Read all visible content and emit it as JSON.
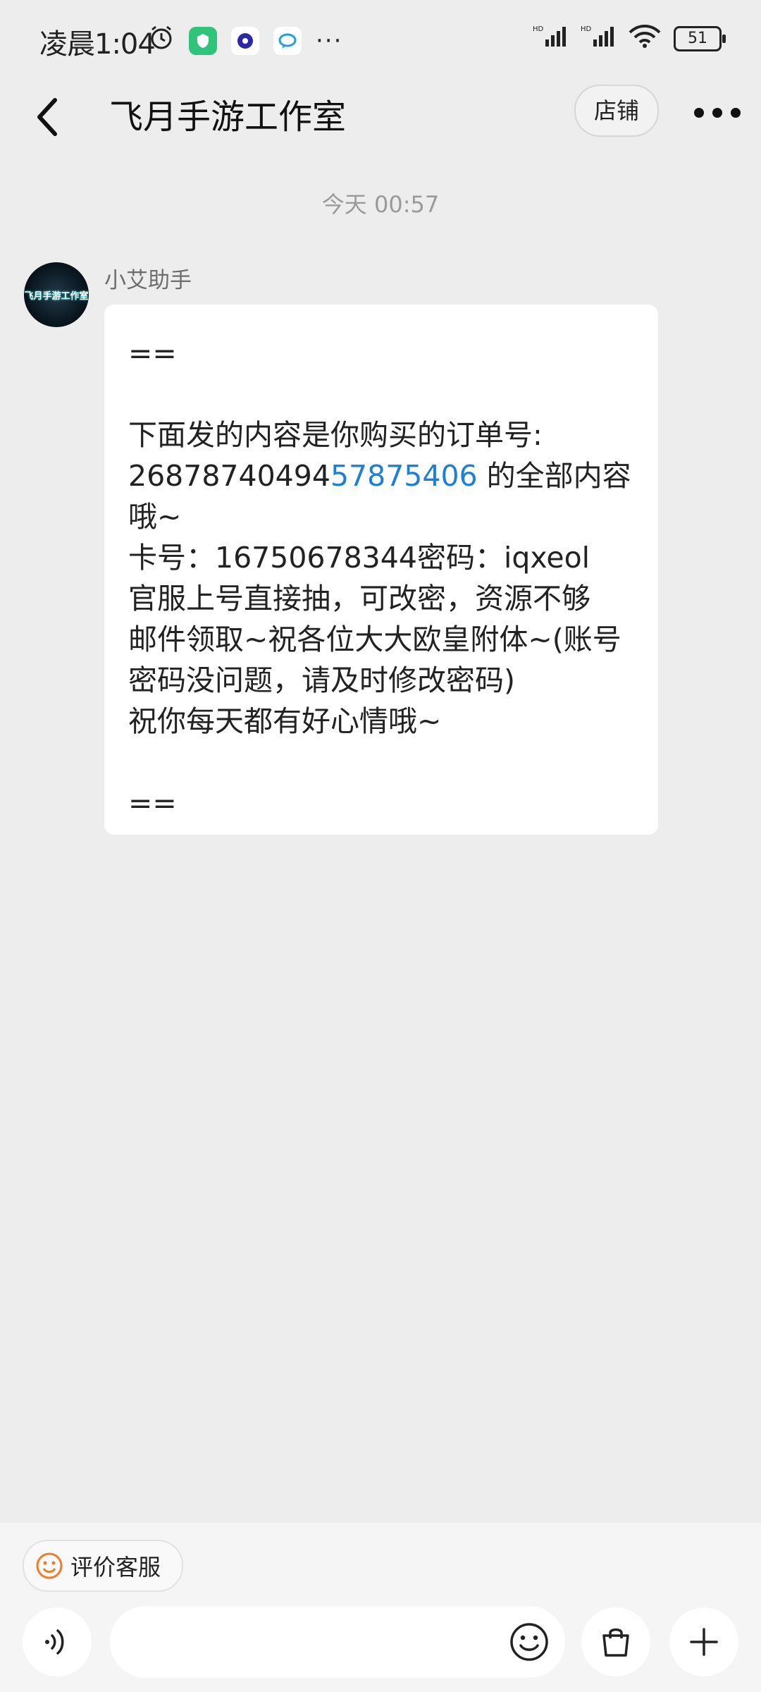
{
  "status_bar": {
    "time": "凌晨1:04",
    "battery": "51",
    "more_label": "···"
  },
  "header": {
    "title": "飞月手游工作室",
    "shop_button": "店铺"
  },
  "chat": {
    "timestamp": "今天  00:57",
    "sender": "小艾助手",
    "avatar_text": "飞月手游工作室",
    "message": {
      "line1": "==",
      "line2": "下面发的内容是你购买的订单号:",
      "line3_prefix": "26878740494",
      "line3_link": "57875406",
      "line3_suffix": " 的全部内容",
      "line4": "哦~",
      "line5": "卡号：16750678344密码：iqxeol",
      "line6": "官服上号直接抽，可改密，资源不够",
      "line7": "邮件领取~祝各位大大欧皇附体~(账号",
      "line8": "密码没问题，请及时修改密码)",
      "line9": "祝你每天都有好心情哦~",
      "line10": "=="
    }
  },
  "bottom": {
    "rate_label": "评价客服"
  },
  "colors": {
    "background": "#ededed",
    "link": "#1e7fd8",
    "rate_icon": "#f07c2a"
  }
}
